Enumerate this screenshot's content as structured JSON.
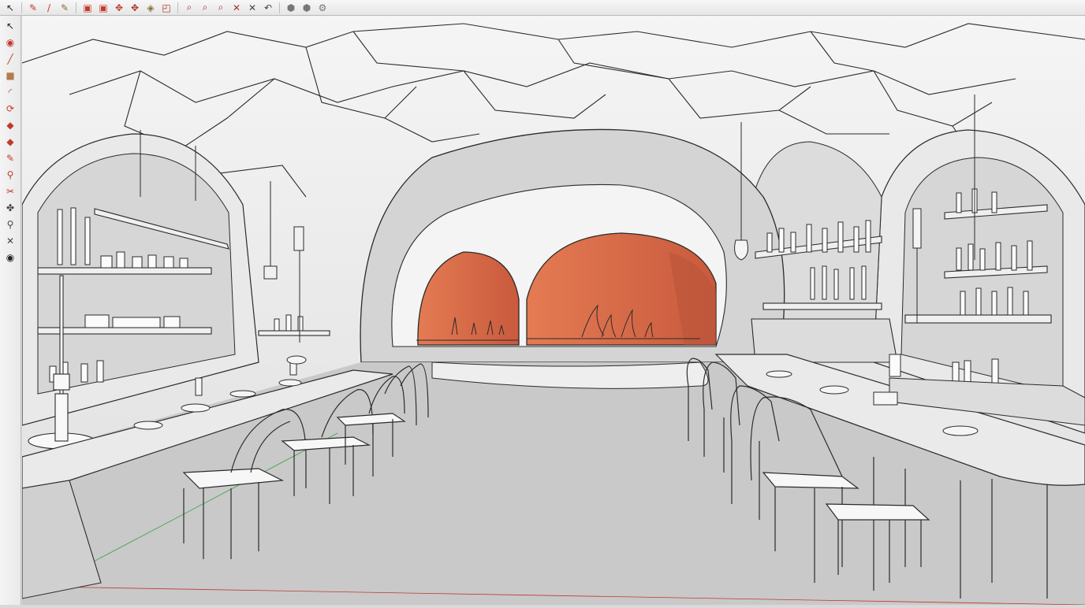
{
  "toolbar": {
    "tools": [
      {
        "name": "select-tool",
        "glyph": "↖",
        "color": "#222222"
      },
      {
        "name": "pencil-tool",
        "glyph": "✎",
        "color": "#c0392b"
      },
      {
        "name": "line-tool",
        "glyph": "/",
        "color": "#c0392b"
      },
      {
        "name": "paint-bucket-tool",
        "glyph": "✎",
        "color": "#8a6d3b"
      },
      {
        "name": "box-tool",
        "glyph": "▣",
        "color": "#c0392b"
      },
      {
        "name": "push-pull-tool",
        "glyph": "▣",
        "color": "#c0392b"
      },
      {
        "name": "move-tool",
        "glyph": "✥",
        "color": "#c0392b"
      },
      {
        "name": "rotate-tool",
        "glyph": "✥",
        "color": "#a93226"
      },
      {
        "name": "scale-tool",
        "glyph": "◈",
        "color": "#8a6d3b"
      },
      {
        "name": "offset-tool",
        "glyph": "◰",
        "color": "#a93226"
      },
      {
        "name": "zoom-tool",
        "glyph": "⌕",
        "color": "#a93226"
      },
      {
        "name": "zoom-window-tool",
        "glyph": "⌕",
        "color": "#a93226"
      },
      {
        "name": "zoom-extents-tool",
        "glyph": "⌕",
        "color": "#a93226"
      },
      {
        "name": "section-plane-tool",
        "glyph": "✕",
        "color": "#a93226"
      },
      {
        "name": "erase-tool",
        "glyph": "✕",
        "color": "#444444"
      },
      {
        "name": "undo-tool",
        "glyph": "↶",
        "color": "#444444"
      },
      {
        "name": "shade-tool",
        "glyph": "⬢",
        "color": "#777777"
      },
      {
        "name": "texture-tool",
        "glyph": "⬢",
        "color": "#777777"
      },
      {
        "name": "settings-gear",
        "glyph": "⚙",
        "color": "#777777"
      }
    ]
  },
  "left_tools": [
    {
      "name": "select-tool",
      "glyph": "↖",
      "color": "#222222"
    },
    {
      "name": "eraser-tool",
      "glyph": "◉",
      "color": "#c0392b"
    },
    {
      "name": "line-tool",
      "glyph": "╱",
      "color": "#c0392b"
    },
    {
      "name": "rectangle-tool",
      "glyph": "■",
      "color": "#b07d4f"
    },
    {
      "name": "arc-tool",
      "glyph": "◜",
      "color": "#c0392b"
    },
    {
      "name": "follow-me-tool",
      "glyph": "⟳",
      "color": "#c0392b"
    },
    {
      "name": "push-pull-tool",
      "glyph": "◆",
      "color": "#c0392b"
    },
    {
      "name": "rotate-tool",
      "glyph": "◆",
      "color": "#c0392b"
    },
    {
      "name": "tape-measure-tool",
      "glyph": "✎",
      "color": "#c0392b"
    },
    {
      "name": "dimension-tool",
      "glyph": "⚲",
      "color": "#c0392b"
    },
    {
      "name": "protractor-tool",
      "glyph": "✂",
      "color": "#c0392b"
    },
    {
      "name": "orbit-tool",
      "glyph": "✤",
      "color": "#444444"
    },
    {
      "name": "pan-tool",
      "glyph": "⚲",
      "color": "#444444"
    },
    {
      "name": "zoom-extents-tool",
      "glyph": "✕",
      "color": "#444444"
    },
    {
      "name": "walk-tool",
      "glyph": "◉",
      "color": "#222222"
    }
  ],
  "colors": {
    "fire_orange": "#e0714a",
    "fire_dark": "#b8533a",
    "floor": "#c9c9c9",
    "wall": "#f2f2f2",
    "line": "#2b2b2b",
    "axis_red": "#c0392b",
    "axis_green": "#3aa24a",
    "axis_blue": "#3355cc"
  }
}
